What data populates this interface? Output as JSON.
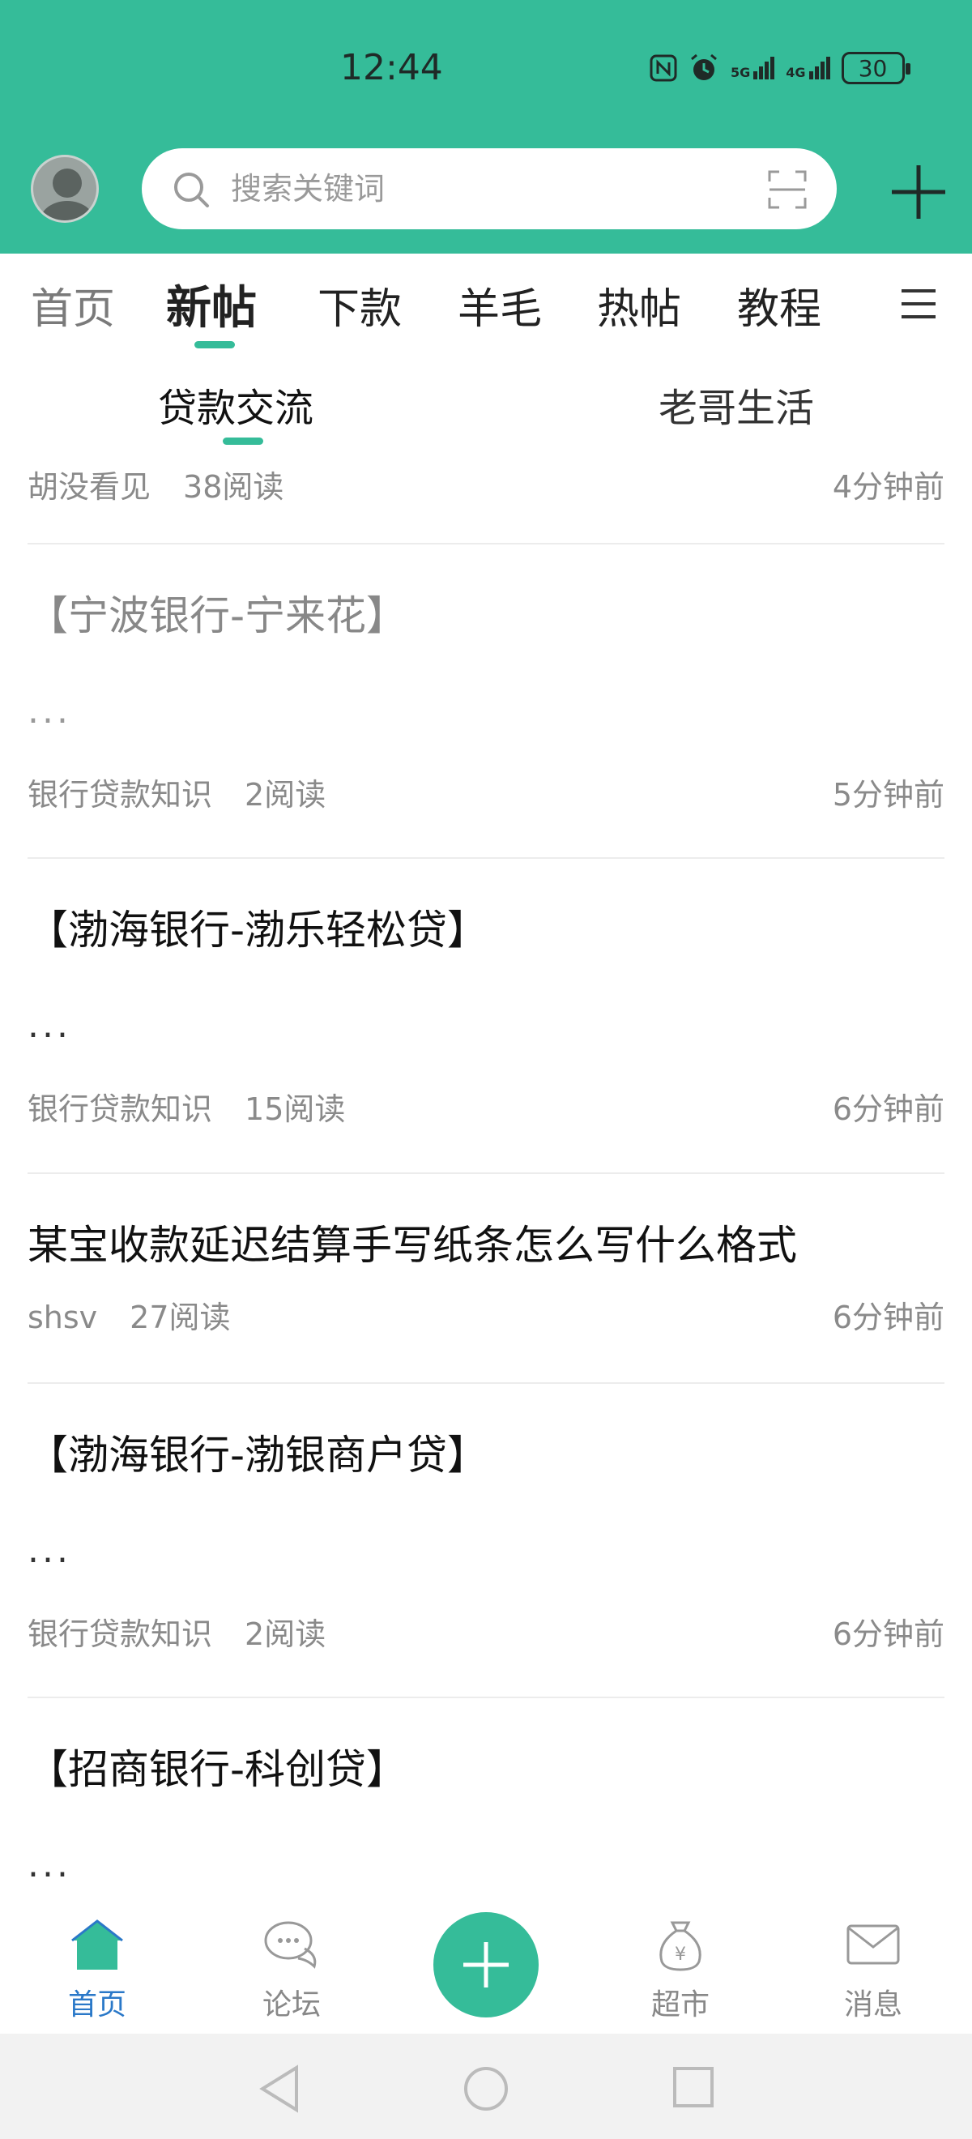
{
  "status_bar": {
    "time": "12:44",
    "network_5g": "5G",
    "network_4g": "4G",
    "battery": "30"
  },
  "search": {
    "placeholder": "搜索关键词"
  },
  "tabs": [
    {
      "label": "首页"
    },
    {
      "label": "新帖",
      "selected": true
    },
    {
      "label": "下款"
    },
    {
      "label": "羊毛"
    },
    {
      "label": "热帖"
    },
    {
      "label": "教程"
    }
  ],
  "subtabs": [
    {
      "label": "贷款交流",
      "selected": true
    },
    {
      "label": "老哥生活"
    }
  ],
  "posts": [
    {
      "title": "",
      "excerpt": "",
      "author": "胡没看见",
      "reads": "38阅读",
      "time": "4分钟前"
    },
    {
      "title": "【宁波银行-宁来花】",
      "excerpt": "...",
      "author": "银行贷款知识",
      "reads": "2阅读",
      "time": "5分钟前"
    },
    {
      "title": "【渤海银行-渤乐轻松贷】",
      "excerpt": "...",
      "author": "银行贷款知识",
      "reads": "15阅读",
      "time": "6分钟前"
    },
    {
      "title": "某宝收款延迟结算手写纸条怎么写什么格式",
      "excerpt": "",
      "author": "shsv",
      "reads": "27阅读",
      "time": "6分钟前"
    },
    {
      "title": "【渤海银行-渤银商户贷】",
      "excerpt": "...",
      "author": "银行贷款知识",
      "reads": "2阅读",
      "time": "6分钟前"
    },
    {
      "title": "【招商银行-科创贷】",
      "excerpt": "...",
      "author": "",
      "reads": "",
      "time": ""
    }
  ],
  "bottom_nav": [
    {
      "label": "首页",
      "icon": "home-icon",
      "selected": true
    },
    {
      "label": "论坛",
      "icon": "chat-bubble-icon"
    },
    {
      "label": "",
      "icon": "plus-icon"
    },
    {
      "label": "超市",
      "icon": "money-bag-icon"
    },
    {
      "label": "消息",
      "icon": "mail-icon"
    }
  ],
  "colors": {
    "accent": "#35bc99",
    "nav_active": "#2a78c8"
  }
}
